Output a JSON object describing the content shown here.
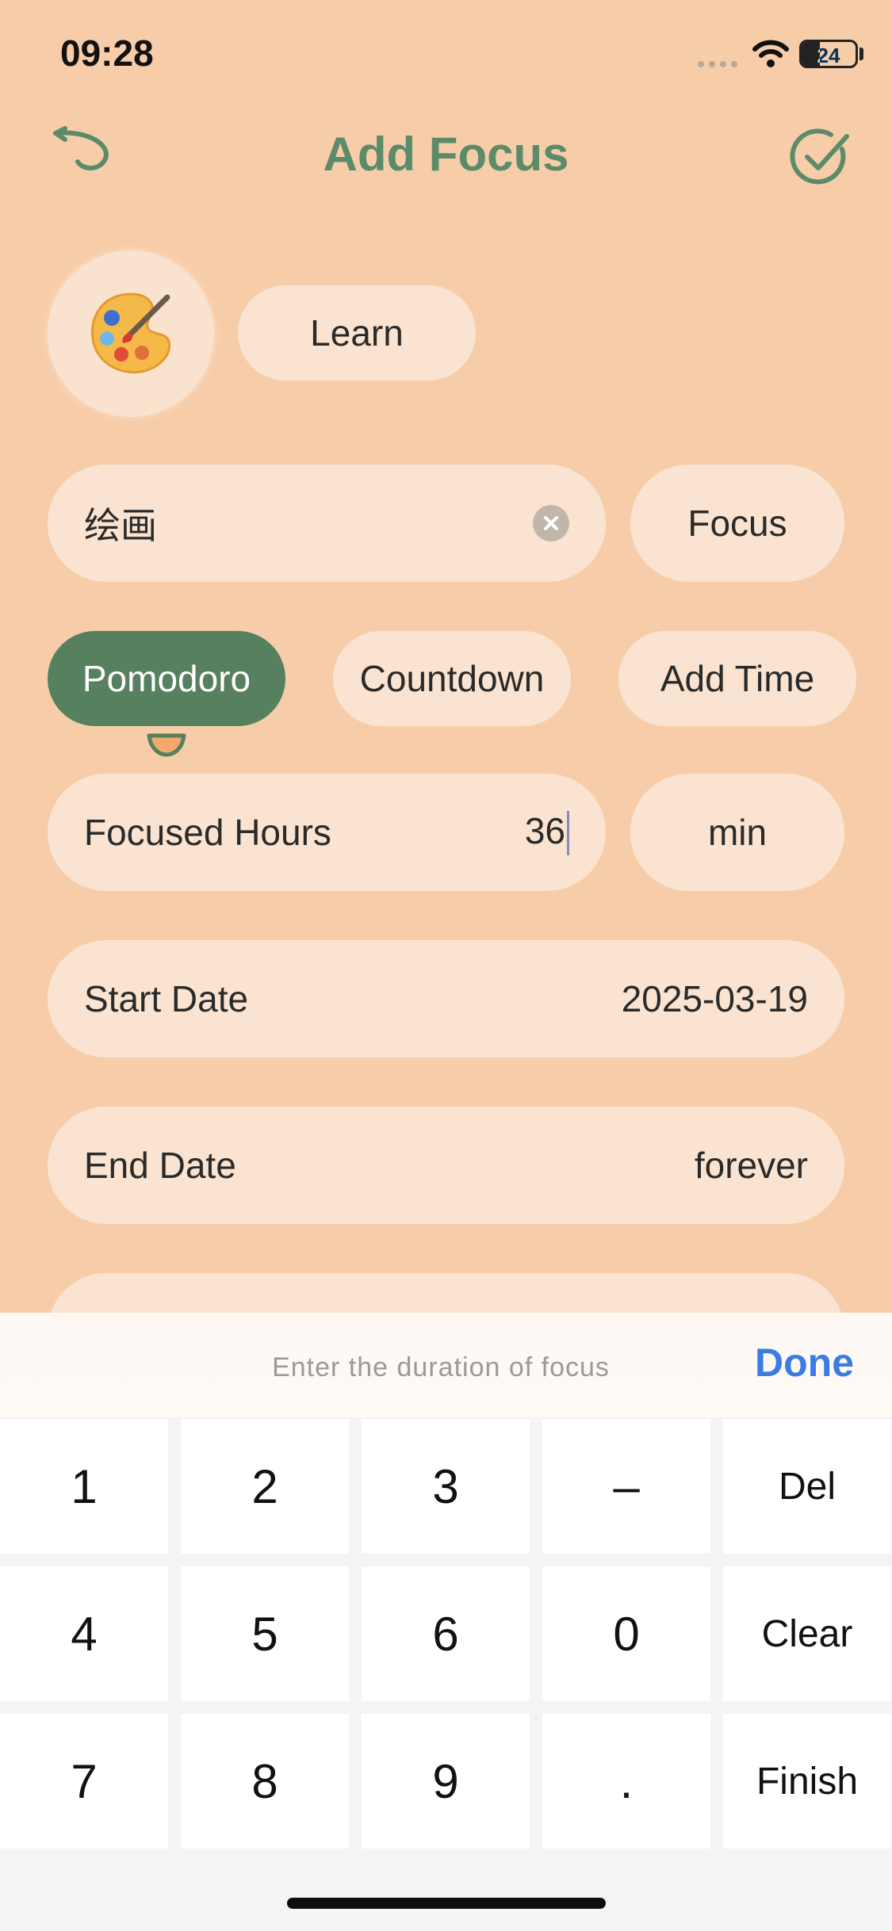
{
  "status_bar": {
    "time": "09:28",
    "battery_level": "24"
  },
  "header": {
    "title": "Add Focus",
    "back_icon": "back-arrow-icon",
    "confirm_icon": "check-circle-icon"
  },
  "focus_icon": "palette-icon",
  "category": "Learn",
  "name_field": {
    "value": "绘画"
  },
  "type_pill": "Focus",
  "tabs": [
    {
      "label": "Pomodoro",
      "selected": true
    },
    {
      "label": "Countdown",
      "selected": false
    },
    {
      "label": "Add Time",
      "selected": false
    }
  ],
  "focused_hours": {
    "label": "Focused Hours",
    "value": "36",
    "unit": "min"
  },
  "start_date": {
    "label": "Start Date",
    "value": "2025-03-19"
  },
  "end_date": {
    "label": "End Date",
    "value": "forever"
  },
  "keyboard": {
    "hint": "Enter the duration of focus",
    "done": "Done",
    "rows": [
      [
        "1",
        "2",
        "3",
        "–",
        "Del"
      ],
      [
        "4",
        "5",
        "6",
        "0",
        "Clear"
      ],
      [
        "7",
        "8",
        "9",
        ".",
        "Finish"
      ]
    ]
  },
  "colors": {
    "background": "#F7CDA9",
    "pill": "#FAE4D1",
    "accent_green": "#57805F",
    "title_green": "#5C8B6A",
    "done_blue": "#3C7BE3"
  }
}
